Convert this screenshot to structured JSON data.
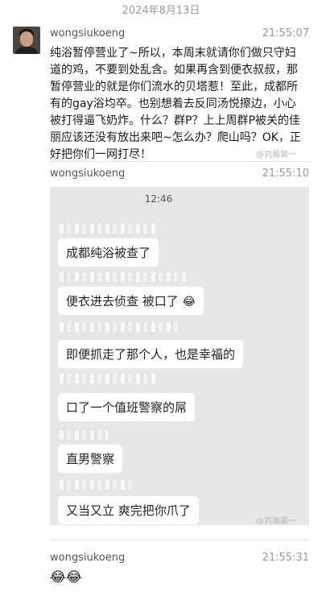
{
  "date_divider": "2024年8月13日",
  "messages": [
    {
      "author": "wongsiukoeng",
      "time": "21:55:07",
      "text": "纯浴暂停营业了~所以，本周末就请你们做只守妇道的鸡，不要到处乱含。如果再含到便衣叔叔，那暂停营业的就是你们流水的贝塔惹！至此，成都所有的gay浴均卒。也别想着去反同汤悦擦边，小心被打得逼飞奶炸。什么？群P？上上周群P被关的佳丽应该还没有放出来吧~怎么办？爬山吗？OK，正好把你们一网打尽！",
      "watermark": "@刘瀚第一"
    },
    {
      "author": "wongsiukoeng",
      "time": "21:55:10",
      "screenshot": {
        "clock": "12:46",
        "bubbles": [
          "成都纯浴被查了",
          "便衣进去侦查 被口了",
          "即便抓走了那个人，也是幸福的",
          "口了一个值班警察的屌",
          "直男警察",
          "又当又立 爽完把你爪了"
        ],
        "bubble_emoji": "😂",
        "watermark": "@刘瀚第一"
      }
    },
    {
      "author": "wongsiukoeng",
      "time": "21:55:31",
      "text": "😂😂"
    }
  ]
}
